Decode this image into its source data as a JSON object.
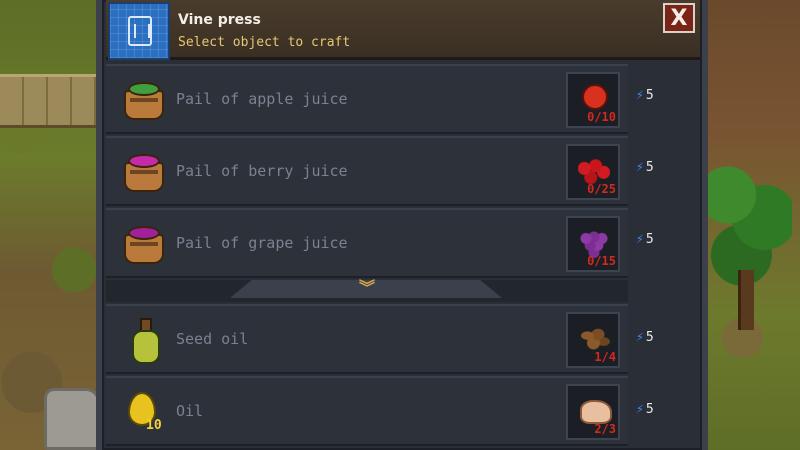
{
  "window": {
    "title": "Vine press",
    "subtitle": "Select object to craft",
    "close_label": "X"
  },
  "recipes": [
    {
      "name": "Pail of apple juice",
      "icon": "pail-apple-juice-icon",
      "liquid_color": "#3fa040",
      "ingredient": {
        "icon": "apple-icon",
        "count": "0/10"
      },
      "energy": "5"
    },
    {
      "name": "Pail of berry juice",
      "icon": "pail-berry-juice-icon",
      "liquid_color": "#c62aa8",
      "ingredient": {
        "icon": "berries-icon",
        "count": "0/25"
      },
      "energy": "5"
    },
    {
      "name": "Pail of grape juice",
      "icon": "pail-grape-juice-icon",
      "liquid_color": "#a2209a",
      "ingredient": {
        "icon": "grapes-icon",
        "count": "0/15"
      },
      "energy": "5"
    },
    {
      "name": "Seed oil",
      "icon": "seed-oil-bottle-icon",
      "ingredient": {
        "icon": "seeds-icon",
        "count": "1/4"
      },
      "energy": "5"
    },
    {
      "name": "Oil",
      "icon": "oil-drop-icon",
      "quantity": "10",
      "ingredient": {
        "icon": "flour-icon",
        "count": "2/3"
      },
      "energy": "5"
    }
  ],
  "colors": {
    "panel": "#2c313a",
    "disabled_text": "#7c8190",
    "missing_count": "#d22a1f",
    "energy_bolt": "#3f88ff",
    "subtitle": "#e7c873"
  }
}
